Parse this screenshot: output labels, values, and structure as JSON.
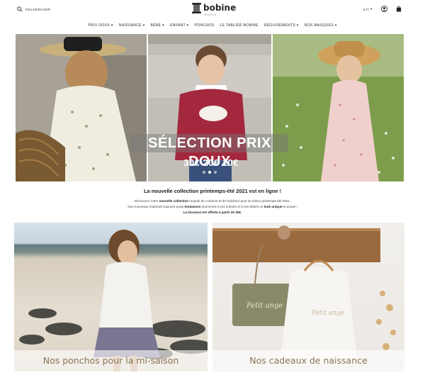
{
  "header": {
    "search_label": "RECHERCHER",
    "logo_word": "bobine",
    "logo_sub": "PARIS",
    "lang": "€ Fr"
  },
  "nav": [
    {
      "label": "PRIX DOUX",
      "caret": true
    },
    {
      "label": "NAISSANCE",
      "caret": true
    },
    {
      "label": "BÉBÉ",
      "caret": true
    },
    {
      "label": "ENFANT",
      "caret": true
    },
    {
      "label": "PONCHOS",
      "caret": false
    },
    {
      "label": "LE TABLIER BOBINE",
      "caret": false
    },
    {
      "label": "DÉGUISEMENTS",
      "caret": true
    },
    {
      "label": "NOS MASQUES",
      "caret": true
    }
  ],
  "hero": {
    "title": "SÉLECTION PRIX DOUX",
    "prices": "30€  20€  10€",
    "slide_count": 3,
    "active_slide": 1
  },
  "intro": {
    "title": "La nouvelle collection printemps-été 2021 est en ligne !",
    "line1_a": "Découvrez notre ",
    "line1_b": "nouvelle collection",
    "line1_c": " remplie de couleurs et de fraîcheur pour la saison printemps-été 2021.",
    "line2_a": "Nos nouveaux imprimés toujours aussi ",
    "line2_b": "tendances",
    "line2_c": " donneront à vos enfants et à vos bébés un ",
    "line2_d": "look unique",
    "line2_e": " et actuel !",
    "line3": "La livraison est offerte à partir de 35€."
  },
  "tiles": [
    {
      "label": "Nos ponchos pour la mi-saison"
    },
    {
      "label": "Nos cadeaux de naissance"
    }
  ],
  "colors": {
    "text": "#222222",
    "tile_label": "#8a7354",
    "banner_overlay": "#787878"
  }
}
